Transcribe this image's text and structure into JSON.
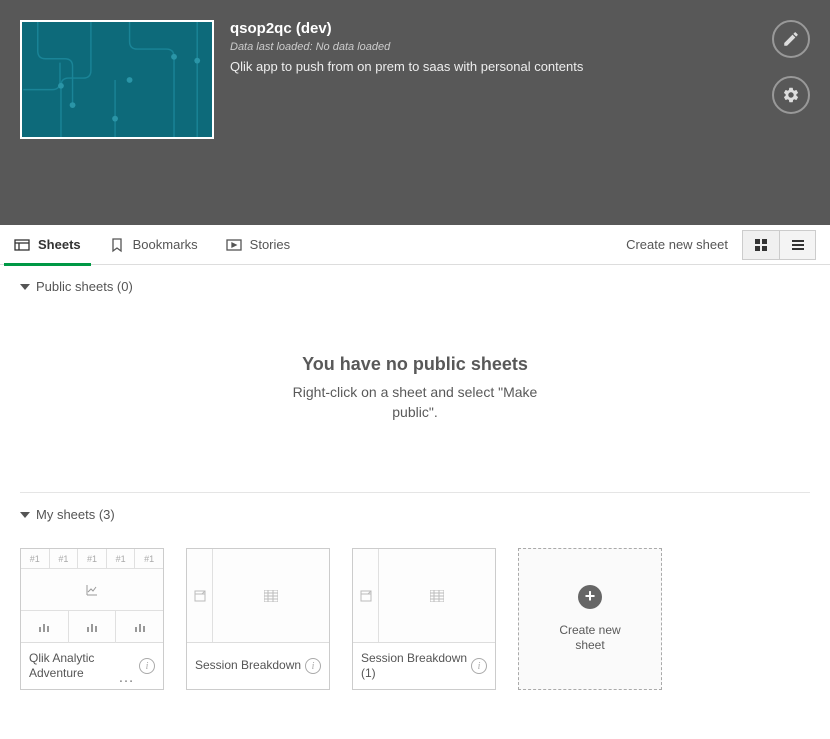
{
  "header": {
    "title": "qsop2qc (dev)",
    "subtitle": "Data last loaded: No data loaded",
    "description": "Qlik app to push from on prem to saas with personal contents"
  },
  "tabs": {
    "sheets": "Sheets",
    "bookmarks": "Bookmarks",
    "stories": "Stories"
  },
  "toolbar": {
    "create_new": "Create new sheet"
  },
  "sections": {
    "public": {
      "label": "Public sheets (0)",
      "empty_title": "You have no public sheets",
      "empty_sub": "Right-click on a sheet and select \"Make public\"."
    },
    "my": {
      "label": "My sheets (3)"
    }
  },
  "sheets": [
    {
      "title": "Qlik Analytic Adventure",
      "preview_placeholder": "#1"
    },
    {
      "title": "Session Breakdown"
    },
    {
      "title": "Session Breakdown (1)"
    }
  ],
  "create_card": {
    "label": "Create new sheet"
  }
}
